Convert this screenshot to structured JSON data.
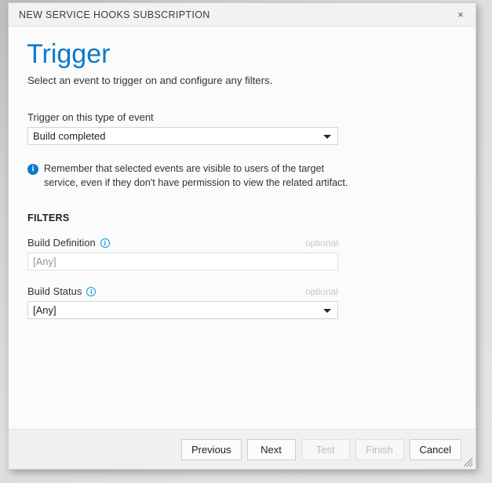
{
  "window": {
    "title": "NEW SERVICE HOOKS SUBSCRIPTION",
    "close_label": "×"
  },
  "header": {
    "title": "Trigger",
    "subtitle": "Select an event to trigger on and configure any filters.",
    "title_color": "#0c7ac9"
  },
  "form": {
    "event_label": "Trigger on this type of event",
    "event_value": "Build completed",
    "info_icon": "info-filled-icon",
    "info_note": "Remember that selected events are visible to users of the target service, even if they don't have permission to view the related artifact."
  },
  "filters": {
    "heading": "FILTERS",
    "optional_tag": "optional",
    "build_definition": {
      "label": "Build Definition",
      "value": "",
      "placeholder": "[Any]",
      "optional": "optional",
      "info_icon": "info-outline-icon"
    },
    "build_status": {
      "label": "Build Status",
      "value": "[Any]",
      "optional": "optional",
      "info_icon": "info-outline-icon"
    }
  },
  "footer": {
    "buttons": [
      {
        "label": "Previous",
        "disabled": false
      },
      {
        "label": "Next",
        "disabled": false
      },
      {
        "label": "Test",
        "disabled": true
      },
      {
        "label": "Finish",
        "disabled": true
      },
      {
        "label": "Cancel",
        "disabled": false
      }
    ]
  },
  "colors": {
    "accent": "#0c7ac9",
    "info_outline": "#0c9ae3",
    "dialog_bg": "#fbfbfb",
    "titlebar_bg": "#f2f2f2",
    "footer_bg": "#f0f0f0"
  }
}
